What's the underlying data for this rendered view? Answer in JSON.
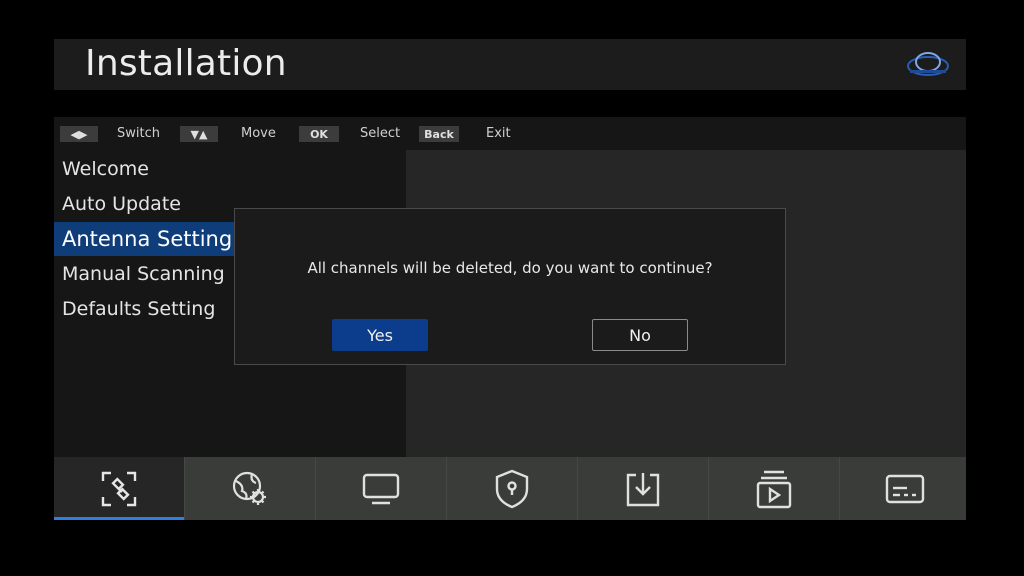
{
  "header": {
    "title": "Installation",
    "logo_icon": "brand-logo-icon"
  },
  "hints": [
    {
      "key": "◀▶",
      "label": "Switch"
    },
    {
      "key": "▼▲",
      "label": "Move"
    },
    {
      "key": "OK",
      "label": "Select"
    },
    {
      "key": "Back",
      "label": "Exit"
    }
  ],
  "menu": {
    "items": [
      {
        "label": "Welcome"
      },
      {
        "label": "Auto Update"
      },
      {
        "label": "Antenna Setting"
      },
      {
        "label": "Manual Scanning"
      },
      {
        "label": "Defaults Setting"
      }
    ],
    "selected": "Antenna Setting"
  },
  "dialog": {
    "message": "All channels will be deleted, do you want to continue?",
    "yes_label": "Yes",
    "no_label": "No",
    "focused": "Yes"
  },
  "tabs": [
    {
      "icon": "satellite-icon",
      "active": true
    },
    {
      "icon": "globe-settings-icon"
    },
    {
      "icon": "tv-icon"
    },
    {
      "icon": "shield-lock-icon"
    },
    {
      "icon": "download-icon"
    },
    {
      "icon": "media-playlist-icon"
    },
    {
      "icon": "subtitle-card-icon"
    }
  ],
  "colors": {
    "accent": "#0c3d8c",
    "highlight": "#0f3d7a",
    "underline": "#2f7fe0"
  }
}
